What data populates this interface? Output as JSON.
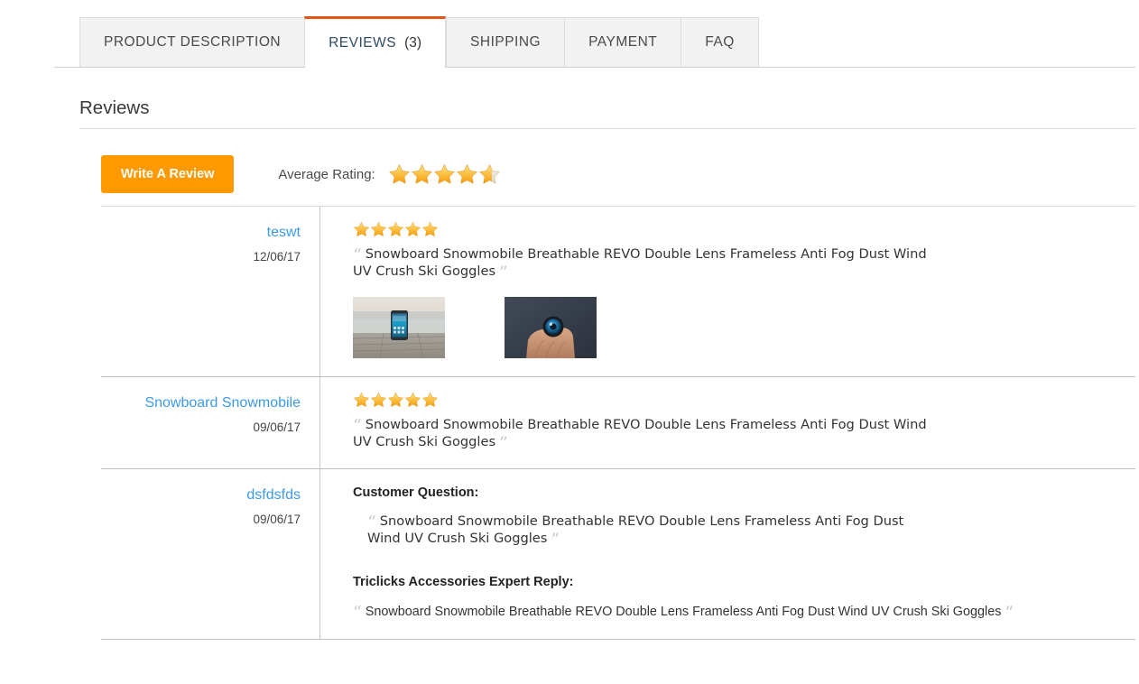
{
  "tabs": [
    {
      "label": "PRODUCT DESCRIPTION",
      "count": "",
      "active": false
    },
    {
      "label": "REVIEWS",
      "count": "(3)",
      "active": true
    },
    {
      "label": "SHIPPING",
      "count": "",
      "active": false
    },
    {
      "label": "PAYMENT",
      "count": "",
      "active": false
    },
    {
      "label": "FAQ",
      "count": "",
      "active": false
    }
  ],
  "section": {
    "title": "Reviews"
  },
  "actions": {
    "write_review_label": "Write A Review",
    "average_rating_label": "Average Rating:",
    "average_rating_value": 4.6,
    "average_rating_max": 5
  },
  "colors": {
    "accent_orange": "#ff9900",
    "tab_active_border": "#e2561c",
    "link_blue": "#3d9ae8",
    "star_gold": "#f5a623",
    "quote_gray": "#c9c9c9"
  },
  "reviews": [
    {
      "author": "teswt",
      "date": "12/06/17",
      "rating": 5,
      "quote_open": "“",
      "quote_close": "”",
      "text": "Snowboard Snowmobile Breathable REVO Double Lens Frameless Anti Fog Dust Wind UV Crush Ski Goggles",
      "thumbnails": [
        {
          "name": "smartphone-on-dock-thumbnail"
        },
        {
          "name": "hand-holding-device-thumbnail"
        }
      ]
    },
    {
      "author": "Snowboard Snowmobile",
      "date": "09/06/17",
      "rating": 5,
      "quote_open": "“",
      "quote_close": "”",
      "text": "Snowboard Snowmobile Breathable REVO Double Lens Frameless Anti Fog Dust Wind UV Crush Ski Goggles",
      "thumbnails": []
    },
    {
      "author": "dsfdsfds",
      "date": "09/06/17",
      "rating": 0,
      "quote_open": "“",
      "quote_close": "”",
      "question_heading": "Customer Question:",
      "question_text": "Snowboard Snowmobile Breathable REVO Double Lens Frameless Anti Fog Dust Wind UV Crush Ski Goggles",
      "reply_heading": "Triclicks Accessories Expert Reply:",
      "reply_text": "Snowboard Snowmobile Breathable REVO Double Lens Frameless Anti Fog Dust Wind UV Crush Ski Goggles",
      "thumbnails": []
    }
  ]
}
